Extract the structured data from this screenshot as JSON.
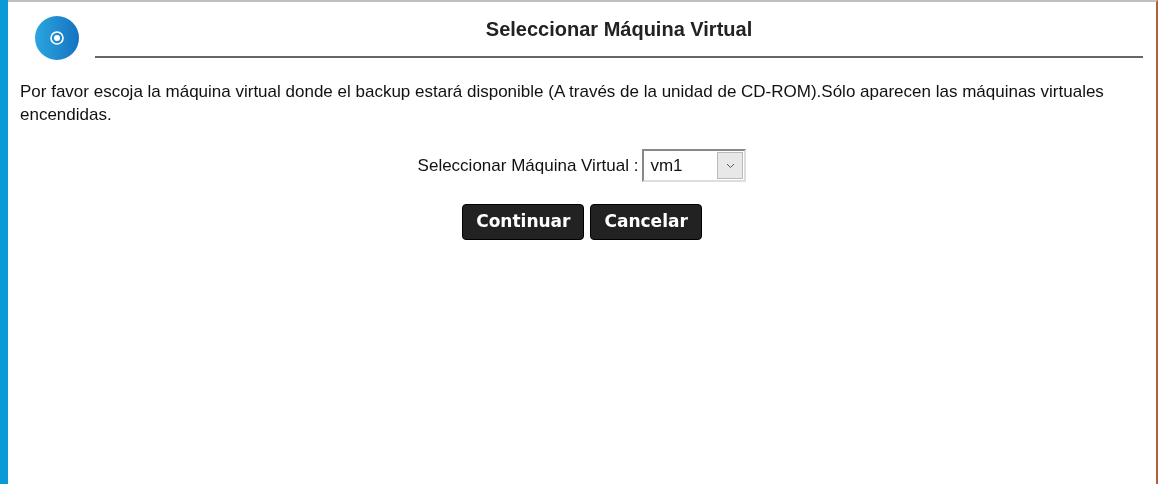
{
  "title": "Seleccionar Máquina Virtual",
  "description": "Por favor escoja la máquina virtual donde el backup estará disponible (A través de la unidad de CD-ROM).Sólo aparecen las máquinas virtuales encendidas.",
  "vm_select": {
    "label": "Seleccionar Máquina Virtual :",
    "value": "vm1"
  },
  "buttons": [
    "Continuar",
    "Cancelar"
  ]
}
